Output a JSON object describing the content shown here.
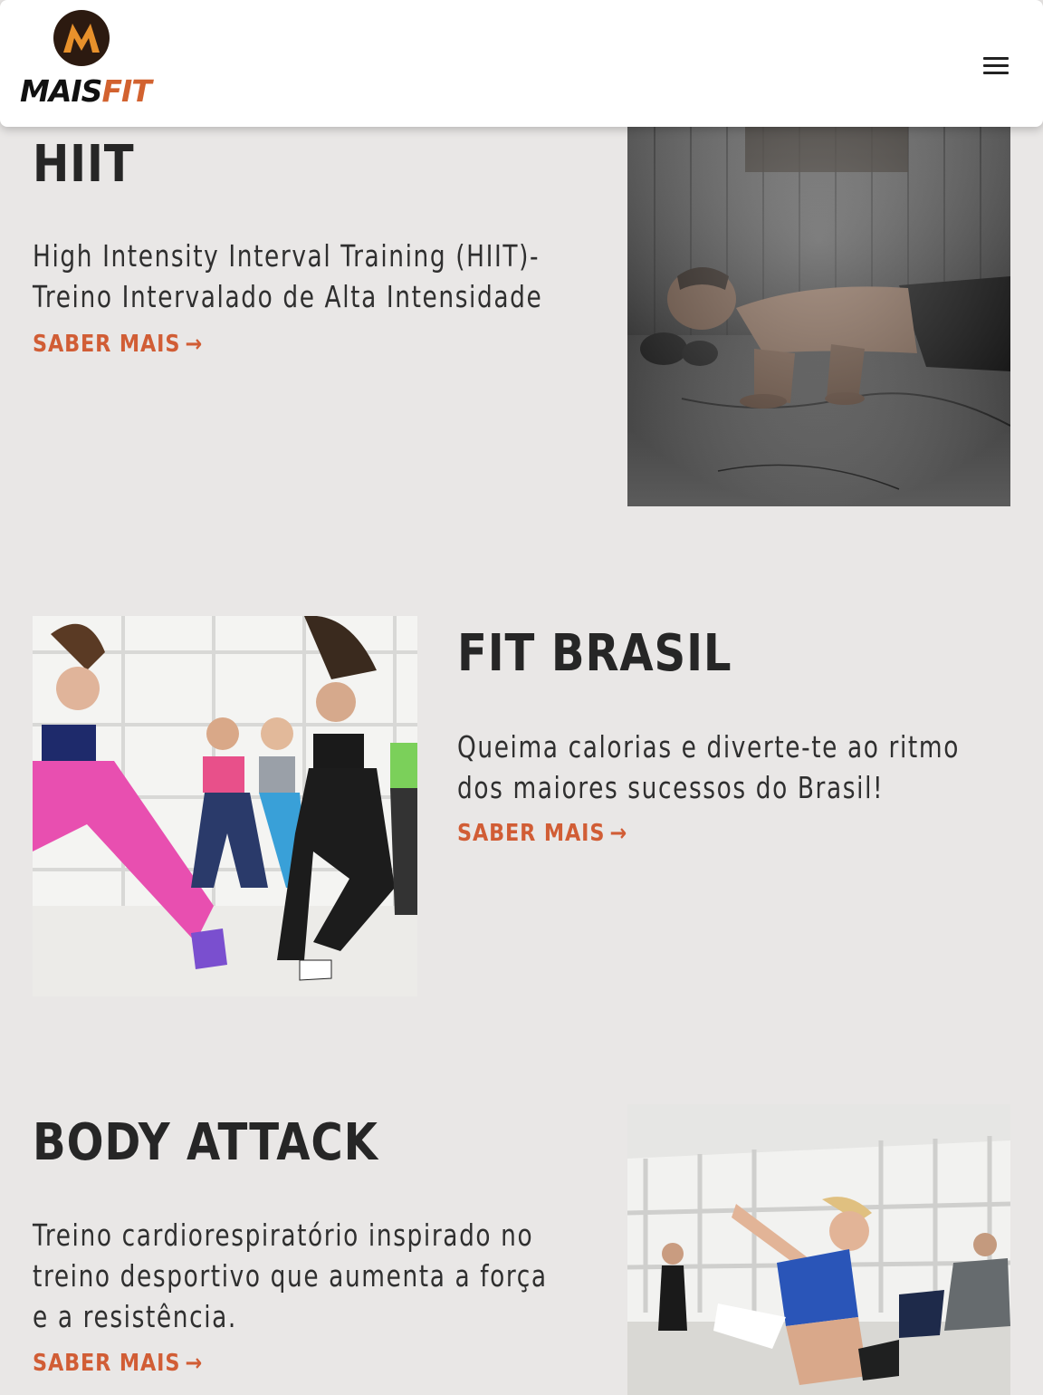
{
  "header": {
    "logo_text_mais": "MAIS",
    "logo_text_fit": "FIT",
    "logo_mark_letter": "M",
    "menu_icon": "hamburger-menu-icon"
  },
  "colors": {
    "accent": "#d15d35",
    "background": "#e9e7e6",
    "text": "#262626",
    "logo_circle": "#2c1a10",
    "logo_orange": "#e8912b"
  },
  "sections": [
    {
      "title": "HIIT",
      "description_lines": [
        "High Intensity Interval Training (HIIT)-",
        "Treino Intervalado de Alta Intensidade"
      ],
      "link_label": "SABER MAIS",
      "link_icon": "arrow-right-icon"
    },
    {
      "title": "FIT BRASIL",
      "description_lines": [
        "Queima calorias e diverte-te ao ritmo",
        "dos maiores sucessos do Brasil!"
      ],
      "link_label": "SABER MAIS",
      "link_icon": "arrow-right-icon"
    },
    {
      "title": "BODY ATTACK",
      "description_lines": [
        "Treino cardiorespiratório inspirado no",
        "treino desportivo que aumenta a força",
        "e a resistência."
      ],
      "link_label": "SABER MAIS",
      "link_icon": "arrow-right-icon"
    }
  ]
}
